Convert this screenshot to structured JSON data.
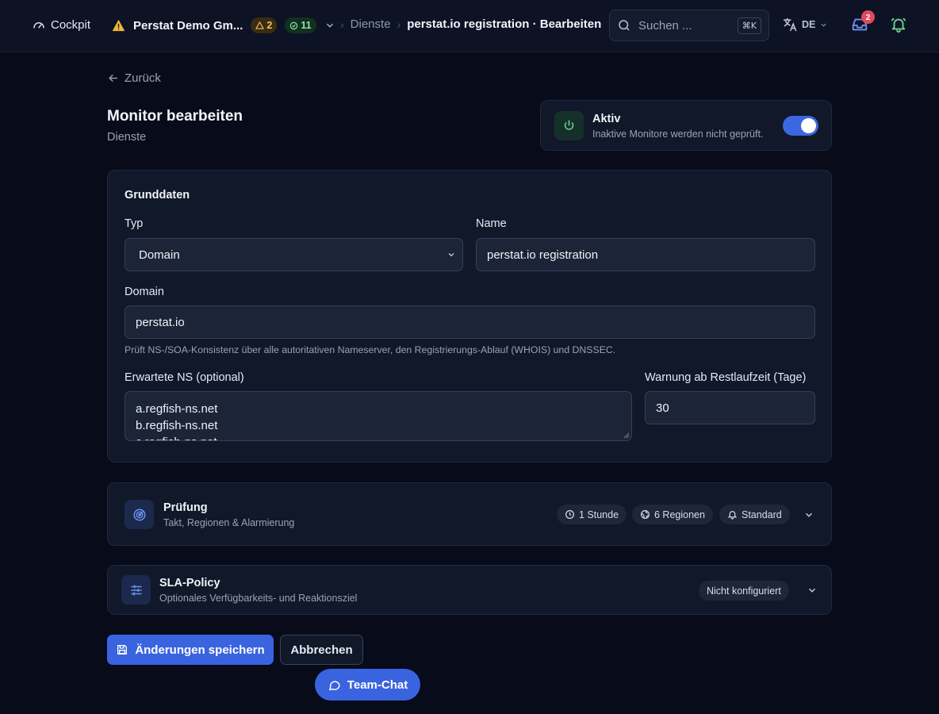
{
  "topbar": {
    "cockpit_label": "Cockpit",
    "org_name": "Perstat Demo Gm...",
    "warning_count": "2",
    "ok_count": "11",
    "breadcrumb_parent": "Dienste",
    "breadcrumb_current": "perstat.io registration · Bearbeiten",
    "search_placeholder": "Suchen ...",
    "search_shortcut": "⌘K",
    "language": "DE",
    "inbox_badge": "2"
  },
  "page": {
    "back_label": "Zurück",
    "title": "Monitor bearbeiten",
    "subtitle": "Dienste"
  },
  "active": {
    "title": "Aktiv",
    "description": "Inaktive Monitore werden nicht geprüft.",
    "enabled": true
  },
  "basics": {
    "section_title": "Grunddaten",
    "type_label": "Typ",
    "type_value": "Domain",
    "name_label": "Name",
    "name_value": "perstat.io registration",
    "domain_label": "Domain",
    "domain_value": "perstat.io",
    "domain_hint": "Prüft NS-/SOA-Konsistenz über alle autoritativen Nameserver, den Registrierungs-Ablauf (WHOIS) und DNSSEC.",
    "ns_label": "Erwartete NS (optional)",
    "ns_lines": [
      "a.regfish-ns.net",
      "b.regfish-ns.net",
      "c.regfish-ns.net"
    ],
    "warn_label": "Warnung ab Restlaufzeit (Tage)",
    "warn_value": "30"
  },
  "pruefung": {
    "title": "Prüfung",
    "description": "Takt, Regionen & Alarmierung",
    "chip_interval": "1 Stunde",
    "chip_regions": "6 Regionen",
    "chip_alerting": "Standard"
  },
  "sla": {
    "title": "SLA-Policy",
    "description": "Optionales Verfügbarkeits- und Reaktionsziel",
    "status": "Nicht konfiguriert"
  },
  "actions": {
    "save_label": "Änderungen speichern",
    "cancel_label": "Abbrechen",
    "chat_label": "Team-Chat"
  },
  "colors": {
    "background": "#070b1a",
    "card": "#111829",
    "accent": "#3a63df",
    "success": "#6fd38f",
    "danger": "#e5485d",
    "warning": "#f0c25a"
  }
}
